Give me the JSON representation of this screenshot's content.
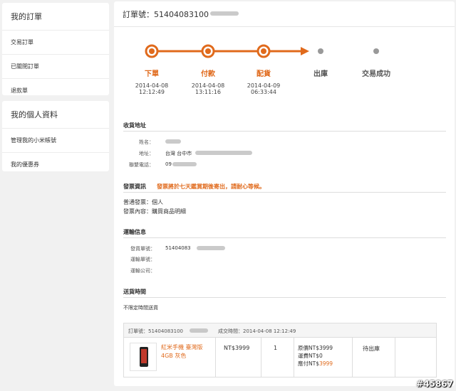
{
  "sidebar": {
    "orders_heading": "我的訂單",
    "order_items": [
      "交易訂單",
      "已關閉訂單",
      "退款單"
    ],
    "profile_heading": "我的個人資料",
    "profile_items": [
      "管理我的小米帳號",
      "我的優惠券"
    ]
  },
  "order": {
    "title": "訂單號：51404083100"
  },
  "progress": {
    "accent": "#e06a1c",
    "inactive": "#999999",
    "steps": [
      {
        "name": "下單",
        "date": "2014-04-08",
        "time": "12:12:49",
        "done": true
      },
      {
        "name": "付款",
        "date": "2014-04-08",
        "time": "13:11:16",
        "done": true
      },
      {
        "name": "配貨",
        "date": "2014-04-09",
        "time": "06:33:44",
        "done": true
      },
      {
        "name": "出庫",
        "date": "",
        "time": "",
        "done": false
      },
      {
        "name": "交易成功",
        "date": "",
        "time": "",
        "done": false
      }
    ]
  },
  "shipping_address": {
    "title": "收貨地址",
    "name_label": "姓名：",
    "address_label": "地址：",
    "address_value": "台灣 台中市",
    "phone_label": "聯繫電話：",
    "phone_value": "09"
  },
  "invoice": {
    "title": "發票資訊",
    "notice": "發票將於七天鑑賞期後寄出，請耐心等候。",
    "type_line": "普通發票：個人",
    "content_line": "發票內容：購買商品明細"
  },
  "transport": {
    "title": "運輸信息",
    "shipment_label": "發貨單號：",
    "shipment_value": "51404083",
    "tracking_label": "運輸單號：",
    "company_label": "運輸公司："
  },
  "delivery": {
    "title": "送貨時間",
    "value": "不限定時間送貨"
  },
  "order_table": {
    "order_no": "訂單號：51404083100",
    "deal_time": "成交時間：2014-04-08 12:12:49",
    "product_name": "紅米手機 臺灣版 4GB 灰色",
    "price": "NT$3999",
    "quantity": "1",
    "original_price": "原價NT$3999",
    "shipping_fee": "運費NT$0",
    "payable_label": "應付NT$",
    "payable_value": "3999",
    "status": "待出庫"
  },
  "watermark": "#45867"
}
